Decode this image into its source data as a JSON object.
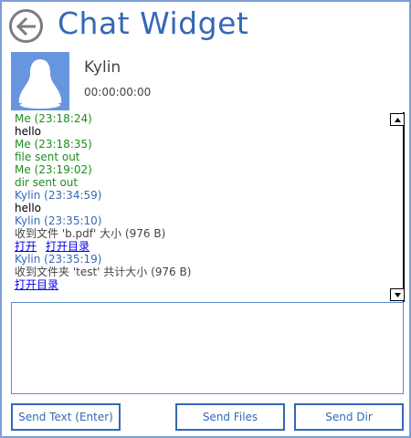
{
  "window": {
    "title": "Chat Widget"
  },
  "peer": {
    "name": "Kylin",
    "time": "00:00:00:00"
  },
  "icons": {
    "back": "back-arrow-icon",
    "avatar": "penguin-avatar-icon",
    "scroll_up": "triangle-up-icon",
    "scroll_down": "triangle-down-icon"
  },
  "colors": {
    "accent": "#3568b7",
    "me": "#1d8d1d",
    "avatar_bg": "#6796e0"
  },
  "messages": [
    {
      "header": "Me (23:18:24)",
      "text": "hello"
    },
    {
      "header": "Me (23:18:35)",
      "text": "file sent out"
    },
    {
      "header": "Me (23:19:02)",
      "text": "dir sent out"
    },
    {
      "header": "Kylin (23:34:59)",
      "text": "hello"
    },
    {
      "header": "Kylin (23:35:10)",
      "text": "收到文件 'b.pdf' 大小 (976 B)",
      "link_open": "打开",
      "link_open_dir": "打开目录"
    },
    {
      "header": "Kylin (23:35:19)",
      "text": "收到文件夹 'test' 共计大小 (976 B)",
      "link_open_dir": "打开目录"
    }
  ],
  "composer": {
    "value": ""
  },
  "buttons": {
    "send_text": "Send Text (Enter)",
    "send_files": "Send Files",
    "send_dir": "Send Dir"
  }
}
